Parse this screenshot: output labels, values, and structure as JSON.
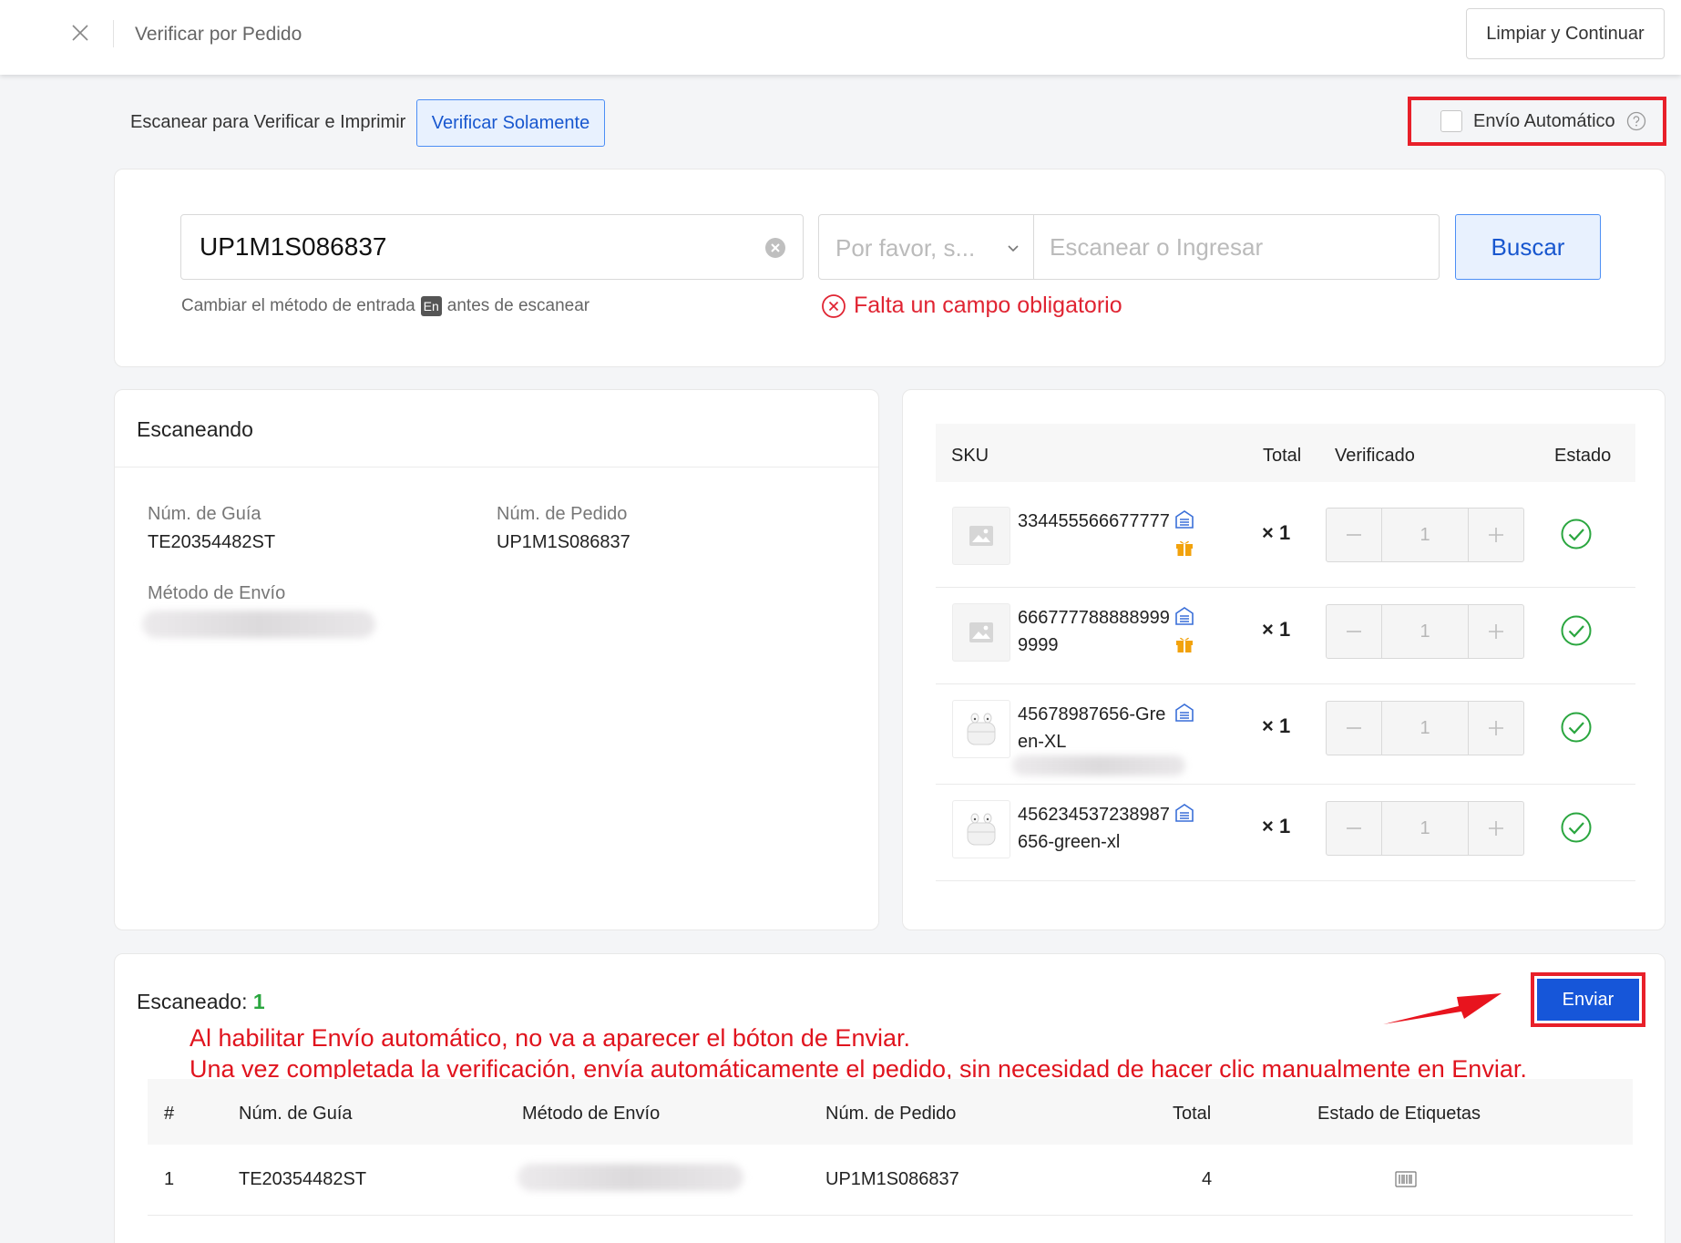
{
  "header": {
    "title": "Verificar por Pedido",
    "limpiar_label": "Limpiar y Continuar"
  },
  "mode": {
    "scan_print_label": "Escanear para Verificar e Imprimir",
    "verify_only_label": "Verificar Solamente",
    "auto_send_label": "Envío Automático",
    "auto_send_checked": false
  },
  "search": {
    "order_value": "UP1M1S086837",
    "hint_before": "Cambiar el método de entrada",
    "hint_badge": "En",
    "hint_after": "antes de escanear",
    "select_placeholder": "Por favor, s...",
    "scan_placeholder": "Escanear o Ingresar",
    "search_label": "Buscar",
    "error_text": "Falta un campo obligatorio"
  },
  "scanning": {
    "title": "Escaneando",
    "guide_label": "Núm. de Guía",
    "guide_value": "TE20354482ST",
    "order_label": "Núm. de Pedido",
    "order_value": "UP1M1S086837",
    "method_label": "Método de Envío"
  },
  "sku_table": {
    "headers": {
      "sku": "SKU",
      "total": "Total",
      "verified": "Verificado",
      "status": "Estado"
    },
    "rows": [
      {
        "sku": "334455566677777",
        "qty": "× 1",
        "verified": "1",
        "thumb": "image-placeholder-icon",
        "gift": true
      },
      {
        "sku": "6667777888889999999",
        "qty": "× 1",
        "verified": "1",
        "thumb": "image-placeholder-icon",
        "gift": true
      },
      {
        "sku": "45678987656-Green-XL",
        "qty": "× 1",
        "verified": "1",
        "thumb": "airpods-icon",
        "gift": false
      },
      {
        "sku": "456234537238987656-green-xl",
        "qty": "× 1",
        "verified": "1",
        "thumb": "airpods-icon",
        "gift": false
      }
    ]
  },
  "bottom": {
    "scanned_label": "Escaneado:",
    "scanned_count": "1",
    "send_label": "Enviar",
    "annotation_line1": "Al habilitar Envío automático, no va a aparecer el bóton de Enviar.",
    "annotation_line2": "Una vez completada la verificación,  envía automáticamente el pedido, sin necesidad de hacer clic manualmente en Enviar.",
    "headers": {
      "index": "#",
      "guide": "Núm. de Guía",
      "method": "Método de Envío",
      "order": "Núm. de Pedido",
      "total": "Total",
      "label_status": "Estado de Etiquetas"
    },
    "rows": [
      {
        "index": "1",
        "guide": "TE20354482ST",
        "order": "UP1M1S086837",
        "total": "4"
      }
    ]
  },
  "colors": {
    "primary": "#1656d9",
    "highlight_border": "#e8202a",
    "error": "#e02432",
    "success": "#2aa63f",
    "annotation": "#e0141e"
  }
}
